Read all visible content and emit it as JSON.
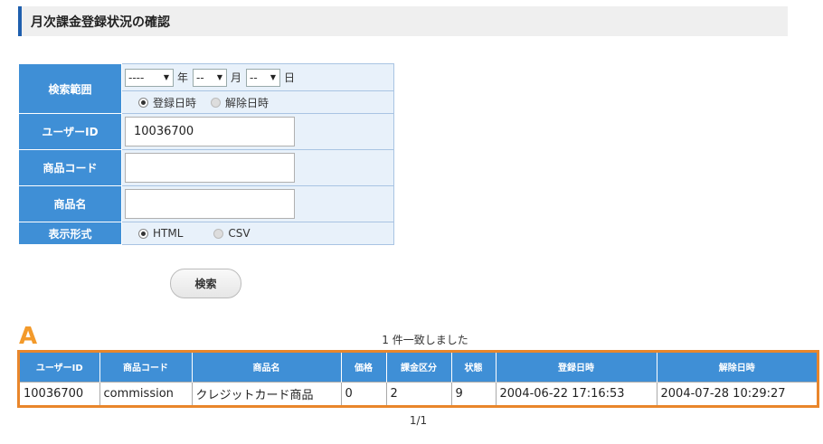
{
  "header": {
    "title": "月次課金登録状況の確認"
  },
  "form": {
    "search_range": {
      "label": "検索範囲",
      "year": {
        "value": "----",
        "unit": "年"
      },
      "month": {
        "value": "--",
        "unit": "月"
      },
      "day": {
        "value": "--",
        "unit": "日"
      },
      "date_type": [
        {
          "label": "登録日時",
          "checked": true
        },
        {
          "label": "解除日時",
          "checked": false
        }
      ]
    },
    "user_id": {
      "label": "ユーザーID",
      "value": "10036700"
    },
    "product_code": {
      "label": "商品コード",
      "value": ""
    },
    "product_name": {
      "label": "商品名",
      "value": ""
    },
    "display_format": {
      "label": "表示形式",
      "options": [
        {
          "label": "HTML",
          "checked": true
        },
        {
          "label": "CSV",
          "checked": false
        }
      ]
    }
  },
  "search_button": "検索",
  "annotation": "A",
  "result": {
    "count_text": "1 件一致しました",
    "columns": [
      "ユーザーID",
      "商品コード",
      "商品名",
      "価格",
      "課金区分",
      "状態",
      "登録日時",
      "解除日時"
    ],
    "rows": [
      [
        "10036700",
        "commission",
        "クレジットカード商品",
        "0",
        "2",
        "9",
        "2004-06-22 17:16:53",
        "2004-07-28 10:29:27"
      ]
    ],
    "pager": "1/1"
  }
}
